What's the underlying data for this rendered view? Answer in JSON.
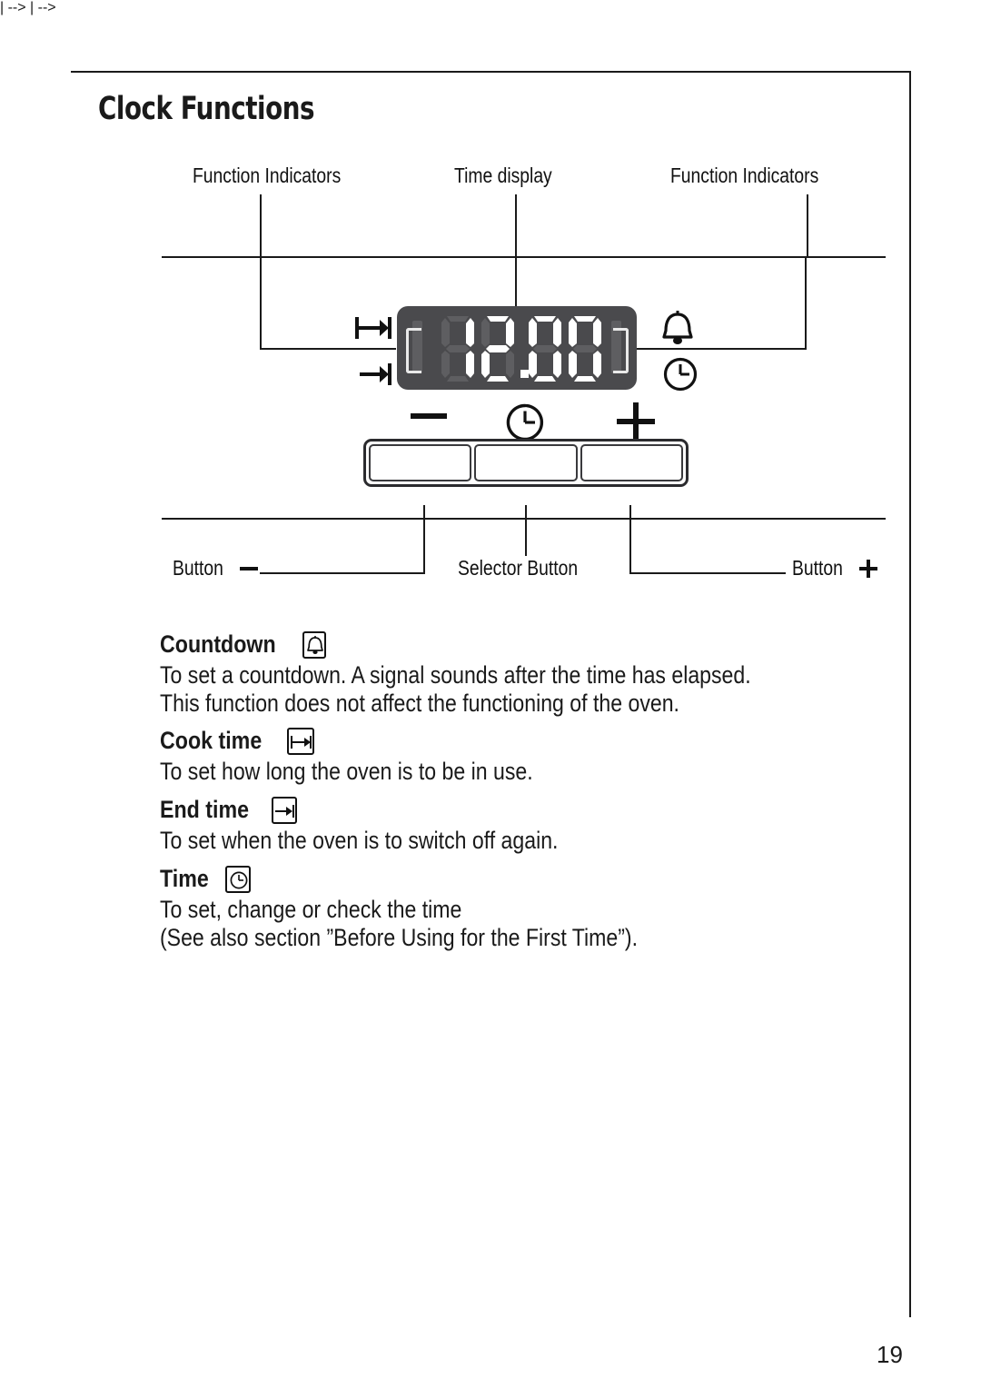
{
  "page": {
    "title": "Clock Functions",
    "number": "19"
  },
  "diagram": {
    "callouts": {
      "function_indicators_left": "Function Indicators",
      "time_display": "Time display",
      "function_indicators_right": "Function Indicators",
      "button_minus": "Button",
      "selector_button": "Selector Button",
      "button_plus": "Button"
    },
    "display": {
      "value": "12.00",
      "digits": [
        "1",
        "2",
        "0",
        "0"
      ],
      "separator": ".",
      "background_color": "#4a4a4d",
      "active_segment_color": "#ffffff",
      "inactive_segment_color": "#5e5e61"
    },
    "indicator_icons": {
      "left_top": "cook-time-icon",
      "left_bottom": "end-time-icon",
      "right_top": "bell-icon",
      "right_bottom": "clock-icon"
    },
    "button_icons": {
      "left": "minus-icon",
      "center": "selector-clock-icon",
      "right": "plus-icon"
    }
  },
  "sections": [
    {
      "heading": "Countdown",
      "icon": "bell-icon",
      "lines": [
        "To set a countdown. A signal sounds after the time has elapsed.",
        "This function does not affect the functioning of the oven."
      ]
    },
    {
      "heading": "Cook time",
      "icon": "cook-time-icon",
      "lines": [
        "To set how long the oven is to be in use."
      ]
    },
    {
      "heading": "End time",
      "icon": "end-time-icon",
      "lines": [
        "To set when the oven is to switch off again."
      ]
    },
    {
      "heading": "Time",
      "icon": "clock-icon",
      "lines": [
        "To set, change or check the time",
        "(See also section ”Before Using for the First Time”)."
      ]
    }
  ]
}
